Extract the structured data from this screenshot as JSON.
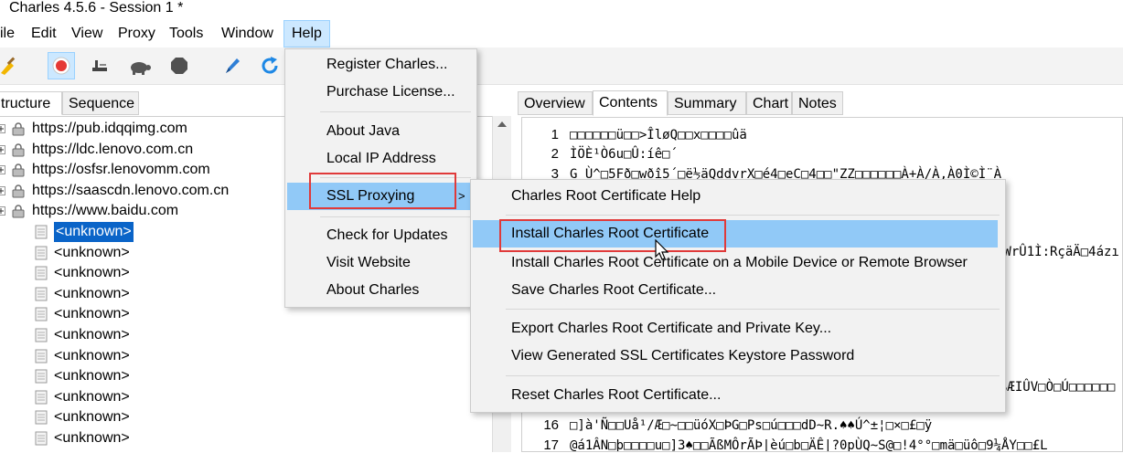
{
  "window": {
    "title": "Charles 4.5.6 - Session 1 *"
  },
  "menubar": {
    "items": [
      "ile",
      "Edit",
      "View",
      "Proxy",
      "Tools",
      "Window",
      "Help"
    ]
  },
  "left_panel": {
    "tabs": [
      "tructure",
      "Sequence"
    ],
    "hosts": [
      "https://pub.idqqimg.com",
      "https://ldc.lenovo.com.cn",
      "https://osfsr.lenovomm.com",
      "https://saascdn.lenovo.com.cn",
      "https://www.baidu.com"
    ],
    "children": [
      "<unknown>",
      "<unknown>",
      "<unknown>",
      "<unknown>",
      "<unknown>",
      "<unknown>",
      "<unknown>",
      "<unknown>",
      "<unknown>",
      "<unknown>",
      "<unknown>"
    ]
  },
  "right_panel": {
    "tabs": [
      "Overview",
      "Contents",
      "Summary",
      "Chart",
      "Notes"
    ],
    "selected_tab": "Contents",
    "lines": [
      {
        "num": "1",
        "text": "□□□□□□ü□□>ÎløQ□□x□□□□ûä"
      },
      {
        "num": "2",
        "text": "ÌÖÈ¹Ò6u□Û:íê□´"
      },
      {
        "num": "3",
        "text": "           G Ù^□5Fð□wðî5´□ë½äQddvrX□é4□eC□4□□\"ZZ□□□□□□À+À/À,À0Ì©Ì¨À"
      }
    ],
    "partial_right_1": "²WrÛ1Ì:RçäÄ□4ázı",
    "partial_right_2": "$ÆIÛV□Ò□Ú□□□□□□",
    "lines_bottom": [
      {
        "num": "16",
        "text": "□]à'Ñ□□Uå¹/Æ□~□□üóX□ÞG□Ps□ú□□□dD~R.♠♠Ú^±¦□×□£□ÿ"
      },
      {
        "num": "17",
        "text": "@á1ÂN□þ□□□□u□]3♠□□ÃßMÔrÃÞ|èú□b□ÄÊ|?0pÙQ~S@□!4°°□mä□üô□9¼ÅY□□£L"
      }
    ]
  },
  "help_menu": {
    "items": [
      "Register Charles...",
      "Purchase License...",
      "About Java",
      "Local IP Address",
      "SSL Proxying",
      "Check for Updates",
      "Visit Website",
      "About Charles"
    ],
    "submenu_arrow": ">"
  },
  "ssl_submenu": {
    "items": [
      "Charles Root Certificate Help",
      "Install Charles Root Certificate",
      "Install Charles Root Certificate on a Mobile Device or Remote Browser",
      "Save Charles Root Certificate...",
      "Export Charles Root Certificate and Private Key...",
      "View Generated SSL Certificates Keystore Password",
      "Reset Charles Root Certificate..."
    ]
  },
  "colors": {
    "highlight": "#91c9f7",
    "annotation_red": "#e03a3a",
    "selection_blue": "#0a64c8"
  }
}
